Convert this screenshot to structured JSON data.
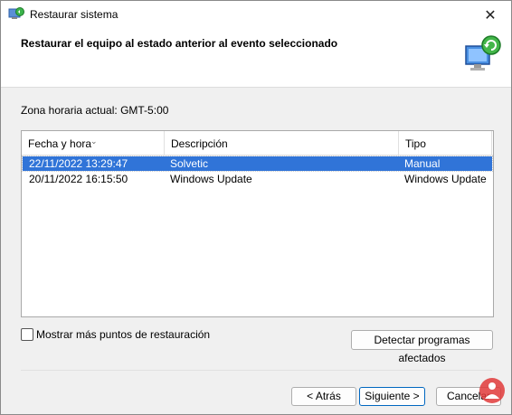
{
  "window": {
    "title": "Restaurar sistema",
    "close_glyph": "✕"
  },
  "header": {
    "title": "Restaurar el equipo al estado anterior al evento seleccionado",
    "graphic_icon": "monitor-restore-icon"
  },
  "timezone_label": "Zona horaria actual: GMT-5:00",
  "table": {
    "columns": [
      "Fecha y hora",
      "Descripción",
      "Tipo"
    ],
    "rows": [
      {
        "date": "22/11/2022 13:29:47",
        "description": "Solvetic",
        "type": "Manual",
        "selected": true
      },
      {
        "date": "20/11/2022 16:15:50",
        "description": "Windows Update",
        "type": "Windows Update",
        "selected": false
      }
    ]
  },
  "show_more_label": "Mostrar más puntos de restauración",
  "buttons": {
    "detect": "Detectar programas afectados",
    "back": "< Atrás",
    "next": "Siguiente >",
    "cancel": "Cancelar"
  },
  "colors": {
    "selection": "#3074d8",
    "accent": "#0067c0"
  }
}
